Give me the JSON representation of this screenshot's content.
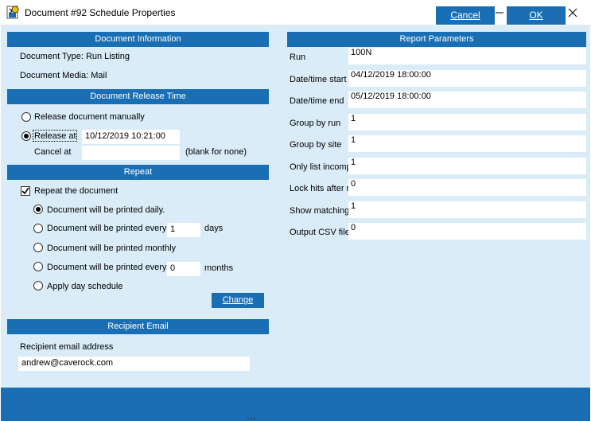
{
  "window": {
    "title": "Document #92 Schedule Properties",
    "icon": "app-icon",
    "controls": [
      "minimize-icon",
      "maximize-icon",
      "close-icon"
    ]
  },
  "document_information": {
    "header": "Document Information",
    "type_line": "Document Type: Run Listing",
    "media_line": "Document Media: Mail"
  },
  "release_time": {
    "header": "Document Release Time",
    "manual_label": "Release document manually",
    "release_at_label": "Release at",
    "release_at_value": "10/12/2019 10:21:00",
    "selected": "release_at",
    "cancel_label": "Cancel at",
    "cancel_value": "",
    "cancel_hint": "(blank for none)"
  },
  "repeat": {
    "header": "Repeat",
    "repeat_checkbox_label": "Repeat the document",
    "repeat_checked": true,
    "daily_label": "Document will be printed daily.",
    "every_days_label": "Document will be printed every",
    "every_days_value": "1",
    "days_unit": "days",
    "monthly_label": "Document will be printed monthly",
    "every_months_label": "Document will be printed every",
    "every_months_value": "0",
    "months_unit": "months",
    "day_schedule_label": "Apply day schedule",
    "selected": "daily",
    "change_button": "Change"
  },
  "recipient": {
    "header": "Recipient Email",
    "address_label": "Recipient email address",
    "address_value": "andrew@caverock.com"
  },
  "report_parameters": {
    "header": "Report Parameters",
    "rows": [
      {
        "label": "Run",
        "value": "100N"
      },
      {
        "label": "Date/time start",
        "value": "04/12/2019 18:00:00"
      },
      {
        "label": "Date/time end",
        "value": "05/12/2019 18:00:00"
      },
      {
        "label": "Group by run",
        "value": "1"
      },
      {
        "label": "Group by site",
        "value": "1"
      },
      {
        "label": "Only list incomp",
        "value": "1"
      },
      {
        "label": "Lock hits after r",
        "value": "0"
      },
      {
        "label": "Show matching",
        "value": "1"
      },
      {
        "label": "Output CSV file",
        "value": "0"
      }
    ]
  },
  "footer": {
    "cancel_button": "Cancel",
    "ok_button": "OK"
  }
}
